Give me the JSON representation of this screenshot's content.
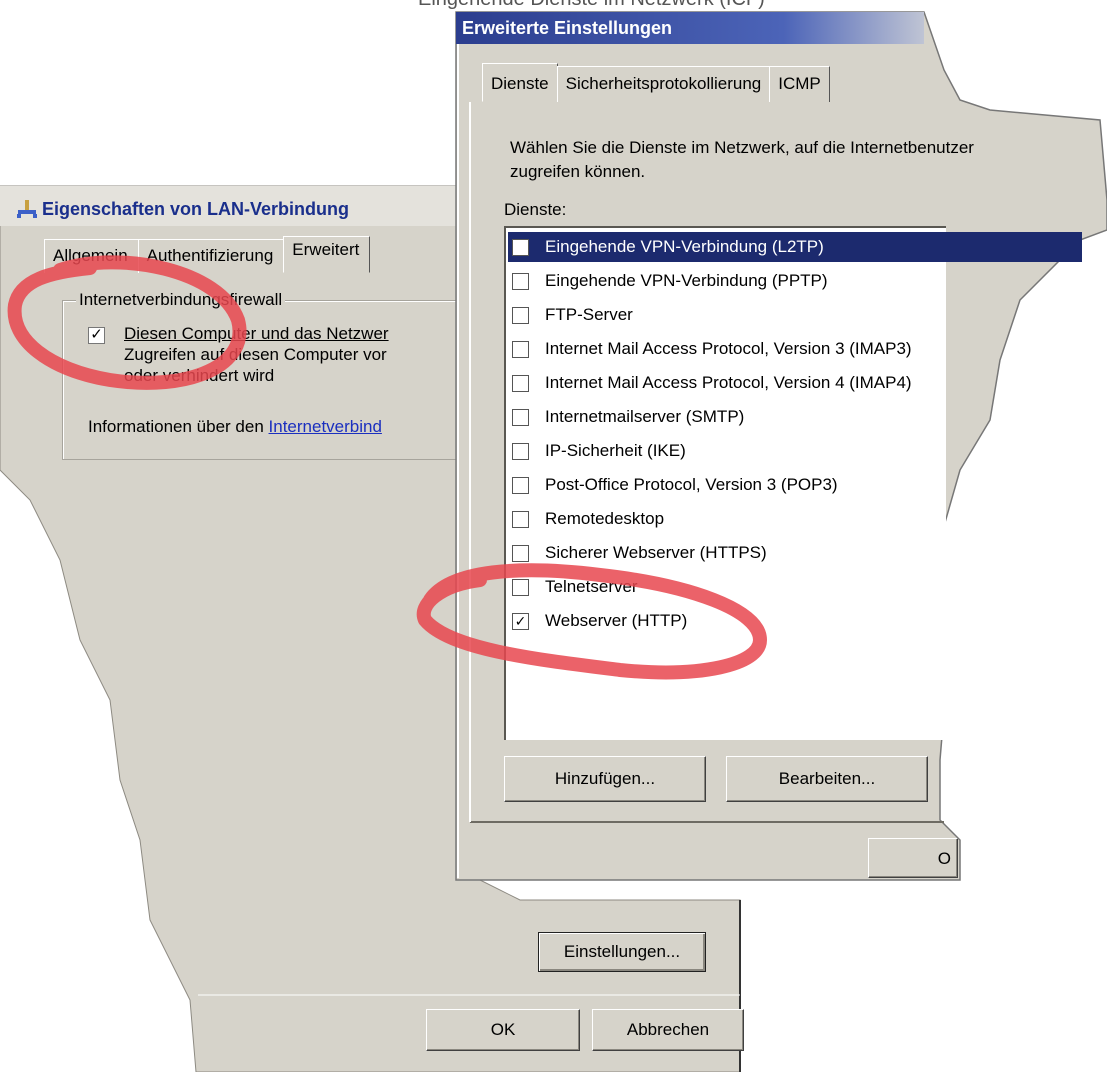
{
  "caption": {
    "text": "Eingehende Dienste im Netzwerk (ICF)"
  },
  "back_dialog": {
    "title": "Eigenschaften von LAN-Verbindung",
    "tabs": [
      "Allgemein",
      "Authentifizierung",
      "Erweitert"
    ],
    "active_tab": "Erweitert",
    "firewall_group_label": "Internetverbindungsfirewall",
    "firewall_checkbox_checked": true,
    "firewall_text_line1": "Diesen Computer und das Netzwer",
    "firewall_text_line2": "Zugreifen auf diesen Computer vor",
    "firewall_text_line3": "oder verhindert wird",
    "info_prefix": "Informationen über den ",
    "info_link": "Internetverbind",
    "settings_button": "Einstellungen...",
    "ok_button": "OK",
    "cancel_button": "Abbrechen"
  },
  "front_dialog": {
    "title": "Erweiterte Einstellungen",
    "tabs": [
      "Dienste",
      "Sicherheitsprotokollierung",
      "ICMP"
    ],
    "active_tab": "Dienste",
    "instruction_line1": "Wählen Sie die Dienste im Netzwerk, auf die Internetbenutzer",
    "instruction_line2": "zugreifen können.",
    "services_label": "Dienste:",
    "services": [
      {
        "label": "Eingehende VPN-Verbindung (L2TP)",
        "checked": false,
        "selected": true
      },
      {
        "label": "Eingehende VPN-Verbindung (PPTP)",
        "checked": false,
        "selected": false
      },
      {
        "label": "FTP-Server",
        "checked": false,
        "selected": false
      },
      {
        "label": "Internet Mail Access Protocol, Version 3 (IMAP3)",
        "checked": false,
        "selected": false
      },
      {
        "label": "Internet Mail Access Protocol, Version 4 (IMAP4)",
        "checked": false,
        "selected": false
      },
      {
        "label": "Internetmailserver (SMTP)",
        "checked": false,
        "selected": false
      },
      {
        "label": "IP-Sicherheit (IKE)",
        "checked": false,
        "selected": false
      },
      {
        "label": "Post-Office Protocol, Version 3 (POP3)",
        "checked": false,
        "selected": false
      },
      {
        "label": "Remotedesktop",
        "checked": false,
        "selected": false
      },
      {
        "label": "Sicherer Webserver (HTTPS)",
        "checked": false,
        "selected": false
      },
      {
        "label": "Telnetserver",
        "checked": false,
        "selected": false
      },
      {
        "label": "Webserver (HTTP)",
        "checked": true,
        "selected": false
      }
    ],
    "add_button": "Hinzufügen...",
    "edit_button": "Bearbeiten...",
    "ok_button": "O"
  },
  "colors": {
    "dialog_face": "#d6d3ca",
    "title_bar": "#2b3d8e",
    "selection": "#1c2a6e",
    "annotation_red": "#e8474f"
  },
  "icons": {
    "network": "network-connection-icon",
    "check": "check-mark"
  }
}
